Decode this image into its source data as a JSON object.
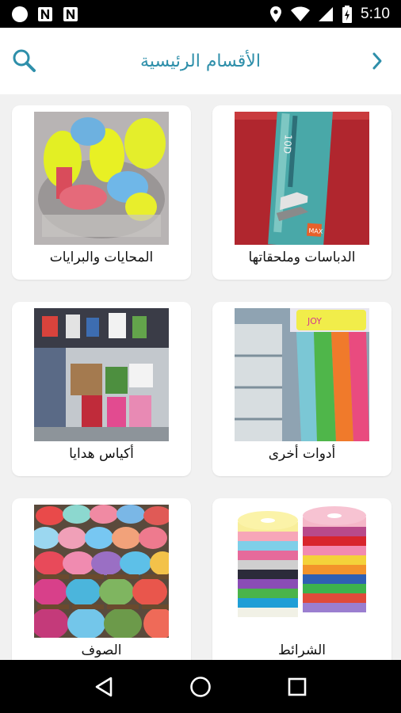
{
  "status_bar": {
    "time": "5:10",
    "left_icons": [
      "circle-notification-icon",
      "n-notification-icon",
      "n-notification-icon"
    ],
    "right_icons": [
      "location-icon",
      "wifi-icon",
      "signal-icon",
      "battery-icon"
    ]
  },
  "header": {
    "title": "الأقسام الرئيسية",
    "search_icon": "search-icon",
    "back_icon": "chevron-right-icon",
    "accent_color": "#2e8faa"
  },
  "categories": [
    {
      "label": "الدباسات وملحقاتها",
      "image": "stapler-box-photo"
    },
    {
      "label": "المحايات والبرايات",
      "image": "erasers-sharpeners-photo"
    },
    {
      "label": "أدوات أخرى",
      "image": "balloons-pack-photo"
    },
    {
      "label": "أكياس هدايا",
      "image": "gift-bags-shop-photo"
    },
    {
      "label": "الشرائط",
      "image": "ribbon-rolls-photo"
    },
    {
      "label": "الصوف",
      "image": "yarn-balls-photo"
    }
  ],
  "nav_bar": {
    "back": "triangle-back-icon",
    "home": "circle-home-icon",
    "recents": "square-recents-icon"
  }
}
